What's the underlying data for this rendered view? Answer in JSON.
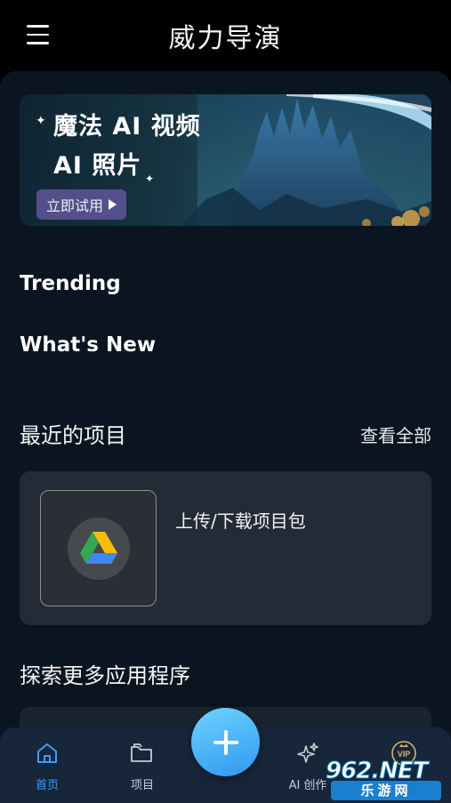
{
  "header": {
    "title": "威力导演",
    "menu_icon": "hamburger-menu-icon"
  },
  "banner": {
    "line1": "魔法 AI 视频",
    "line2": "AI 照片",
    "cta_label": "立即试用",
    "cta_icon": "play-icon"
  },
  "sections": {
    "trending": "Trending",
    "whats_new": "What's New"
  },
  "recent": {
    "title": "最近的项目",
    "view_all": "查看全部",
    "card_label": "上传/下载项目包",
    "card_icon": "google-drive-icon"
  },
  "explore": {
    "title": "探索更多应用程序"
  },
  "nav": {
    "items": [
      {
        "label": "首页",
        "icon": "home-icon",
        "active": true
      },
      {
        "label": "项目",
        "icon": "folder-icon",
        "active": false
      },
      {
        "label": "AI 创作",
        "icon": "sparkle-icon",
        "active": false
      },
      {
        "label": "",
        "icon": "vip-crown-icon",
        "active": false
      }
    ],
    "fab_icon": "plus-icon"
  },
  "watermark": {
    "top": "962.NET",
    "bottom": "乐游网"
  },
  "colors": {
    "background": "#000000",
    "content_bg": "#0b1521",
    "card_bg": "#232b36",
    "nav_bg": "#17263a",
    "accent_blue": "#3d9bff",
    "fab_gradient_start": "#6ed4ff",
    "fab_gradient_end": "#2f97f0",
    "cta_purple": "#685ca8"
  }
}
